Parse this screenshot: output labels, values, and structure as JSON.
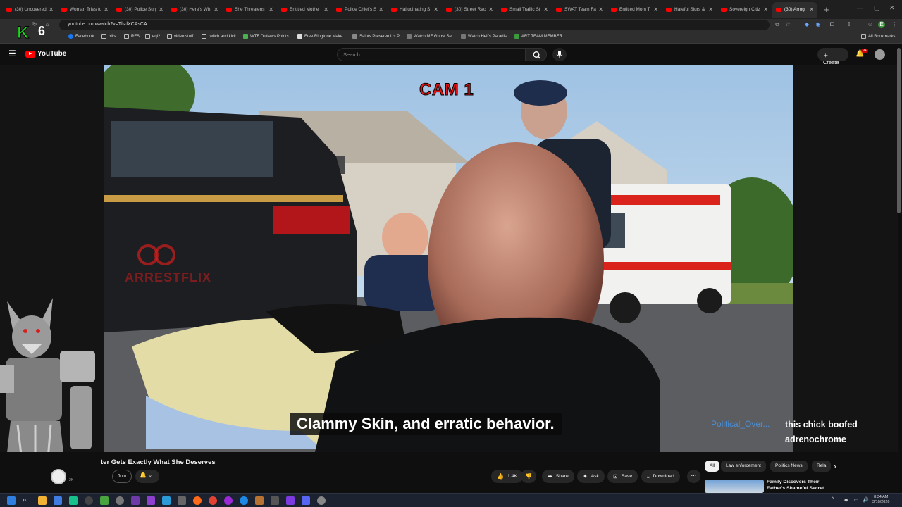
{
  "browser": {
    "tabs": [
      {
        "title": "(30) Uncovered"
      },
      {
        "title": "Woman Tries to"
      },
      {
        "title": "(30) Police Surp"
      },
      {
        "title": "(30) Here's Wh"
      },
      {
        "title": "She Threatens"
      },
      {
        "title": "Entitled Mothe"
      },
      {
        "title": "Police Chief's S"
      },
      {
        "title": "Hallucinating S"
      },
      {
        "title": "(30) Street Rac"
      },
      {
        "title": "Small Traffic St"
      },
      {
        "title": "SWAT Team Fa"
      },
      {
        "title": "Entitled Mom T"
      },
      {
        "title": "Hateful Slurs &"
      },
      {
        "title": "Sovereign Citiz"
      },
      {
        "title": "(30) Arrog"
      }
    ],
    "url": "youtube.com/watch?v=TlsdXCAsCA",
    "bookmarks": [
      {
        "label": "Facebook"
      },
      {
        "label": "bills"
      },
      {
        "label": "RFS"
      },
      {
        "label": "eqi2"
      },
      {
        "label": "video stuff"
      },
      {
        "label": "twitch and kick"
      },
      {
        "label": "WTF Outlaws Points..."
      },
      {
        "label": "Free Ringtone Make..."
      },
      {
        "label": "Saints Preserve Us P..."
      },
      {
        "label": "Watch MF Ghost Se..."
      },
      {
        "label": "Watch Hell's Paradis..."
      },
      {
        "label": "ART TEAM MEMBER..."
      }
    ],
    "all_bookmarks": "All Bookmarks"
  },
  "overlay": {
    "brand_k": "K",
    "brand_six": "6"
  },
  "youtube": {
    "logo": "YouTube",
    "search_placeholder": "Search",
    "create_label": "Create",
    "notif_count": "9+"
  },
  "video": {
    "cam_label": "CAM 1",
    "subtitle": "Clammy Skin, and erratic behavior.",
    "watermark": "ARRESTFLIX",
    "title": "ter Gets Exactly What She Deserves"
  },
  "chat": {
    "user": "Political_Over...",
    "message": "this chick boofed adrenochrome"
  },
  "actions": {
    "join": "Join",
    "like_count": "1.4K",
    "share": "Share",
    "ask": "Ask",
    "save": "Save",
    "download": "Download",
    "subs": "2K"
  },
  "chips": [
    {
      "label": "All"
    },
    {
      "label": "Law enforcement"
    },
    {
      "label": "Politics News"
    },
    {
      "label": "Rela"
    }
  ],
  "recommendation": {
    "title": "Family Discovers Their Father's Shameful Secret"
  },
  "taskbar": {
    "time": "8:34 AM",
    "date": "3/10/2026"
  },
  "colors": {
    "accent_red": "#ff0000",
    "cam_red": "#e01414",
    "chat_user_blue": "#4a8fd8"
  }
}
